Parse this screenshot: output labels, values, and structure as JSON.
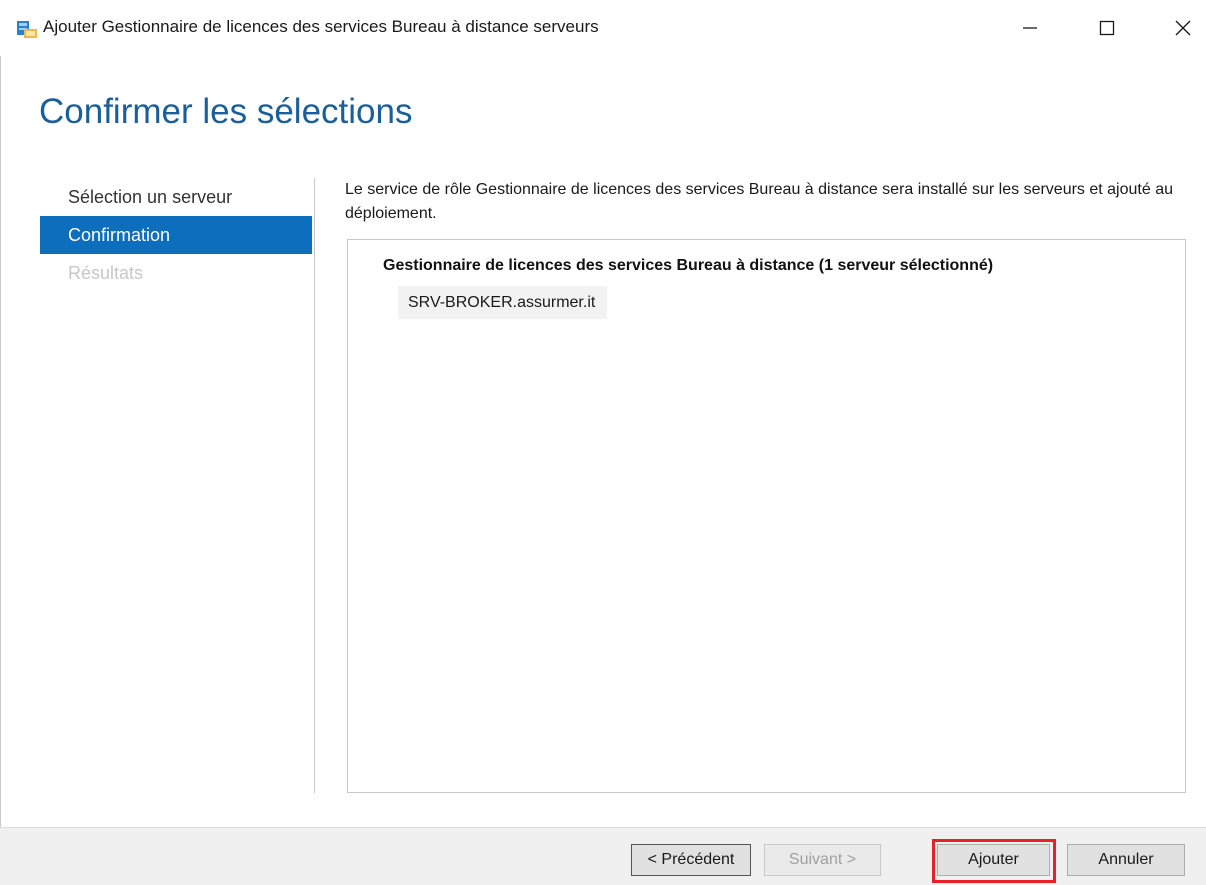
{
  "window": {
    "title": "Ajouter Gestionnaire de licences des services Bureau à distance serveurs",
    "icon": "server-manager-icon",
    "controls": {
      "minimize": "minimize-icon",
      "maximize": "maximize-icon",
      "close": "close-icon"
    }
  },
  "page_title": "Confirmer les sélections",
  "nav": {
    "items": [
      {
        "label": "Sélection un serveur",
        "state": "normal"
      },
      {
        "label": "Confirmation",
        "state": "active"
      },
      {
        "label": "Résultats",
        "state": "disabled"
      }
    ]
  },
  "main": {
    "description": "Le service de rôle Gestionnaire de licences des services Bureau à distance sera installé sur les serveurs et ajouté au déploiement.",
    "role_heading": "Gestionnaire de licences des services Bureau à distance  (1 serveur sélectionné)",
    "servers": [
      "SRV-BROKER.assurmer.it"
    ]
  },
  "footer": {
    "prev_label": "< Précédent",
    "next_label": "Suivant >",
    "add_label": "Ajouter",
    "cancel_label": "Annuler"
  },
  "colors": {
    "accent": "#0c6ebd",
    "title": "#1a5e9a",
    "highlight": "#e8202a"
  }
}
